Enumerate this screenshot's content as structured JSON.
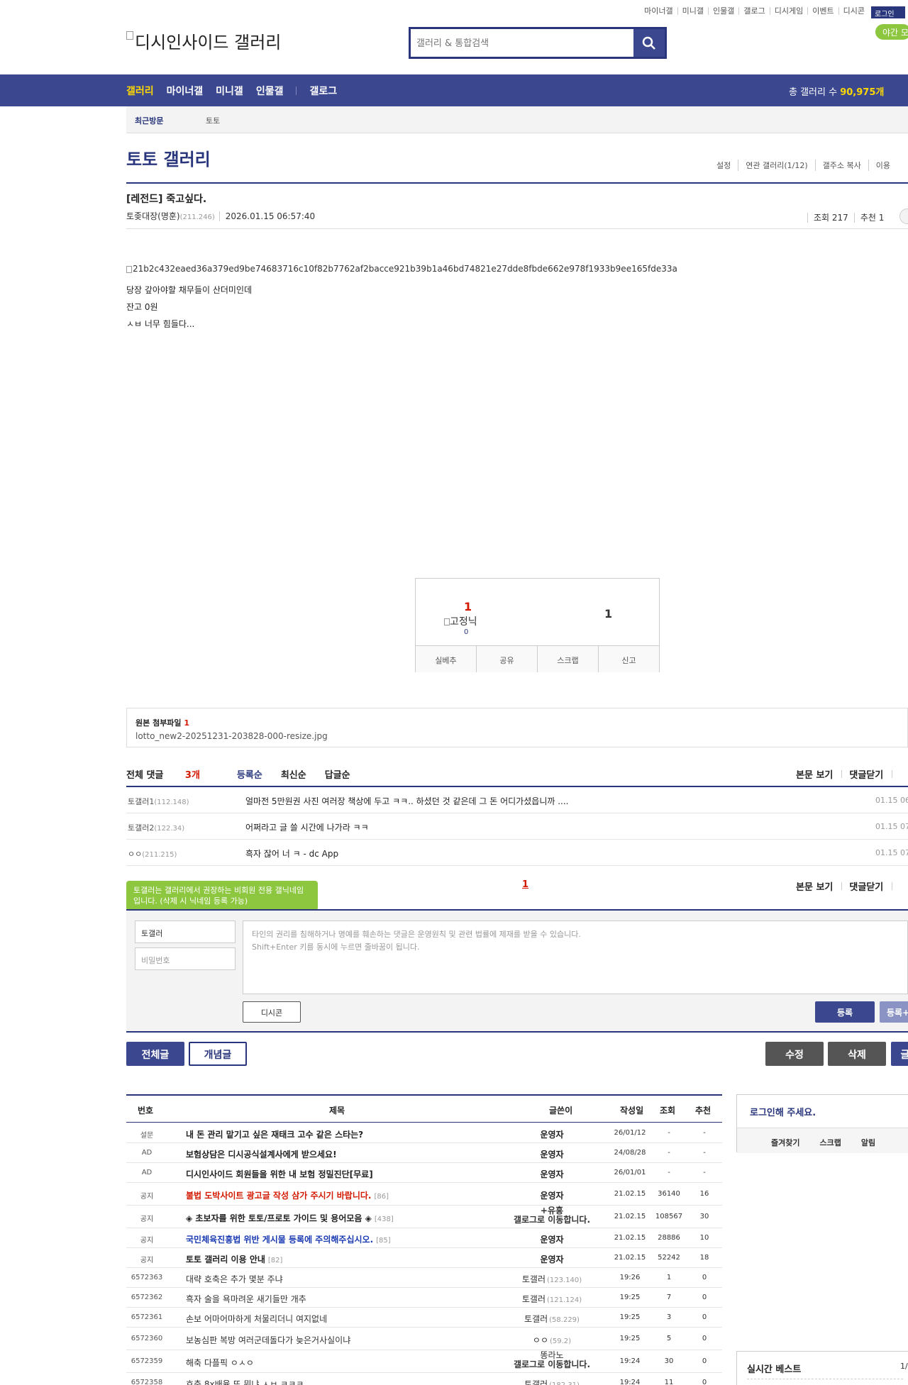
{
  "top_links": [
    "마이너갤",
    "미니갤",
    "인물갤",
    "갤로그",
    "디시게임",
    "이벤트",
    "디시콘"
  ],
  "login_label": "로그인",
  "night_label": "야간 모드",
  "logo_text": "디시인사이드 갤러리",
  "search": {
    "placeholder": "갤러리 & 통합검색"
  },
  "gnb": {
    "items": [
      "갤러리",
      "마이너갤",
      "미니갤",
      "인물갤",
      "갤로그"
    ],
    "count_label": "총 갤러리 수",
    "count_value": "90,975개"
  },
  "recent": {
    "label": "최근방문",
    "item": "토토"
  },
  "gallery": {
    "title": "토토 갤러리",
    "menu": [
      "설정",
      "연관 갤러리(1/12)",
      "갤주소 복사",
      "이용"
    ]
  },
  "post": {
    "title": "[레전드] 죽고싶다.",
    "author": "토좆대장(명훈)",
    "ip": "(211.246)",
    "date": "2026.01.15 06:57:40",
    "views": "조회 217",
    "recommend": "추천 1",
    "image_alt": "21b2c432eaed36a379ed9be74683716c10f82b7762af2bacce921b39b1a46bd74821e27dde8fbde662e978f1933b9ee165fde33a",
    "lines": [
      "당장 갚아야할 채무들이 산더미인데",
      "잔고 0원",
      "ㅅㅂ 너무 힘들다..."
    ]
  },
  "vote": {
    "up": "1",
    "fixed_img": "고정닉",
    "fixed_count": "0",
    "down": "1",
    "buttons": [
      "실베추",
      "공유",
      "스크랩",
      "신고"
    ]
  },
  "attach": {
    "label": "원본 첨부파일",
    "count": "1",
    "file": "lotto_new2-20251231-203828-000-resize.jpg"
  },
  "comments": {
    "total_label": "전체 댓글",
    "total_count": "3개",
    "sorts": [
      "등록순",
      "최신순",
      "답글순"
    ],
    "right": [
      "본문 보기",
      "댓글닫기"
    ],
    "items": [
      {
        "nick": "토갤러1",
        "ip": "(112.148)",
        "text": "얼마전 5만원권 사진 여러장 책상에 두고 ㅋㅋ.. 하셨던 것 같은데 그 돈 어디가셨읍니까 ....",
        "time": "01.15 06"
      },
      {
        "nick": "토갤러2",
        "ip": "(122.34)",
        "text": "어쩌라고 글 쓸 시간에 나가라 ㅋㅋ",
        "time": "01.15 07"
      },
      {
        "nick": "ㅇㅇ",
        "ip": "(211.215)",
        "text": "흑자 잖어 너 ㅋ - dc App",
        "time": "01.15 07"
      }
    ],
    "page": "1",
    "tooltip": "토갤러는 갤러리에서 권장하는 비회원 전용 갤닉네임입니다. (삭제 시 닉네임 등록 가능)",
    "form": {
      "nick": "토갤러",
      "password_placeholder": "비밀번호",
      "textarea_line1": "타인의 권리를 침해하거나 명예를 훼손하는 댓글은 운영원칙 및 관련 법률에 제재를 받을 수 있습니다.",
      "textarea_line2": "Shift+Enter 키를 동시에 누르면 줄바꿈이 됩니다.",
      "dccon": "디시콘",
      "submit": "등록",
      "submit2": "등록+"
    }
  },
  "buttons": {
    "all": "전체글",
    "concept": "개념글",
    "edit": "수정",
    "delete": "삭제",
    "write": "글"
  },
  "list": {
    "headers": [
      "번호",
      "제목",
      "글쓴이",
      "작성일",
      "조회",
      "추천"
    ],
    "rows": [
      {
        "no": "설문",
        "subject": "내 돈 관리 맡기고 싶은 재태크 고수 같은 스타는?",
        "style": "b",
        "cnt": "",
        "writer": "운영자",
        "wstyle": "b",
        "wip": "",
        "date": "26/01/12",
        "views": "-",
        "rec": "-"
      },
      {
        "no": "AD",
        "subject": "보험상담은 디시공식설계사에게 받으세요!",
        "style": "b",
        "cnt": "",
        "writer": "운영자",
        "wstyle": "b",
        "wip": "",
        "date": "24/08/28",
        "views": "-",
        "rec": "-"
      },
      {
        "no": "AD",
        "subject": "디시인사이드 회원들을 위한 내 보험 정밀진단[무료]",
        "style": "b",
        "cnt": "",
        "writer": "운영자",
        "wstyle": "b",
        "wip": "",
        "date": "26/01/01",
        "views": "-",
        "rec": "-"
      },
      {
        "no": "공지",
        "subject": "불법 도박사이트 광고글 작성 삼가 주시기 바랍니다.",
        "style": "red",
        "cnt": "[86]",
        "writer": "운영자",
        "wstyle": "b",
        "wip": "",
        "date": "21.02.15",
        "views": "36140",
        "rec": "16"
      },
      {
        "no": "공지",
        "subject": "◈ 초보자를 위한 토토/프로토 가이드 및 용어모음 ◈",
        "style": "b",
        "cnt": "[438]",
        "writer": "+유흥",
        "wstyle": "b2",
        "wip": "갤로그로 이동합니다.",
        "date": "21.02.15",
        "views": "108567",
        "rec": "30"
      },
      {
        "no": "공지",
        "subject": "국민체육진흥법 위반 게시물 등록에 주의해주십시오.",
        "style": "blue",
        "cnt": "[85]",
        "writer": "운영자",
        "wstyle": "b",
        "wip": "",
        "date": "21.02.15",
        "views": "28886",
        "rec": "10"
      },
      {
        "no": "공지",
        "subject": "토토 갤러리 이용 안내",
        "style": "b",
        "cnt": "[82]",
        "writer": "운영자",
        "wstyle": "b",
        "wip": "",
        "date": "21.02.15",
        "views": "52242",
        "rec": "18"
      },
      {
        "no": "6572363",
        "subject": "대략 호축은 추가 몇분 주냐",
        "style": "",
        "cnt": "",
        "writer": "토갤러",
        "wstyle": "",
        "wip": "(123.140)",
        "date": "19:26",
        "views": "1",
        "rec": "0"
      },
      {
        "no": "6572362",
        "subject": "흑자 술을 욕마려운 새기들만 개추",
        "style": "",
        "cnt": "",
        "writer": "토갤러",
        "wstyle": "",
        "wip": "(121.124)",
        "date": "19:25",
        "views": "7",
        "rec": "0"
      },
      {
        "no": "6572361",
        "subject": "손보 어마어마하게 처물리더니 여지없네",
        "style": "",
        "cnt": "",
        "writer": "토갤러",
        "wstyle": "",
        "wip": "(58.229)",
        "date": "19:25",
        "views": "3",
        "rec": "0"
      },
      {
        "no": "6572360",
        "subject": "보농심판 복방 여러군데돌다가 늦은거사실이냐",
        "style": "",
        "cnt": "",
        "writer": "ㅇㅇ",
        "wstyle": "",
        "wip": "(59.2)",
        "date": "19:25",
        "views": "5",
        "rec": "0"
      },
      {
        "no": "6572359",
        "subject": "해축 다플픽 ㅇㅅㅇ",
        "style": "",
        "cnt": "",
        "writer": "똥라노",
        "wstyle": "b2n",
        "wip": "갤로그로 이동합니다.",
        "date": "19:24",
        "views": "30",
        "rec": "0"
      },
      {
        "no": "6572358",
        "subject": "호축 8x배율 또 뭐냐 ㅅㅂ ㅋㅋㅋ",
        "style": "",
        "cnt": "",
        "writer": "토갤러",
        "wstyle": "",
        "wip": "(182.31)",
        "date": "19:24",
        "views": "11",
        "rec": "0"
      }
    ]
  },
  "sidebar": {
    "login_prompt": "로그인해 주세요.",
    "links": [
      "즐겨찾기",
      "스크랩",
      "알림"
    ],
    "best_title": "실시간 베스트",
    "best_page": "1/"
  },
  "colors": {
    "brand": "#3b4890",
    "accent": "#ffd800",
    "night": "#8dc63f",
    "alert": "#d31900"
  }
}
